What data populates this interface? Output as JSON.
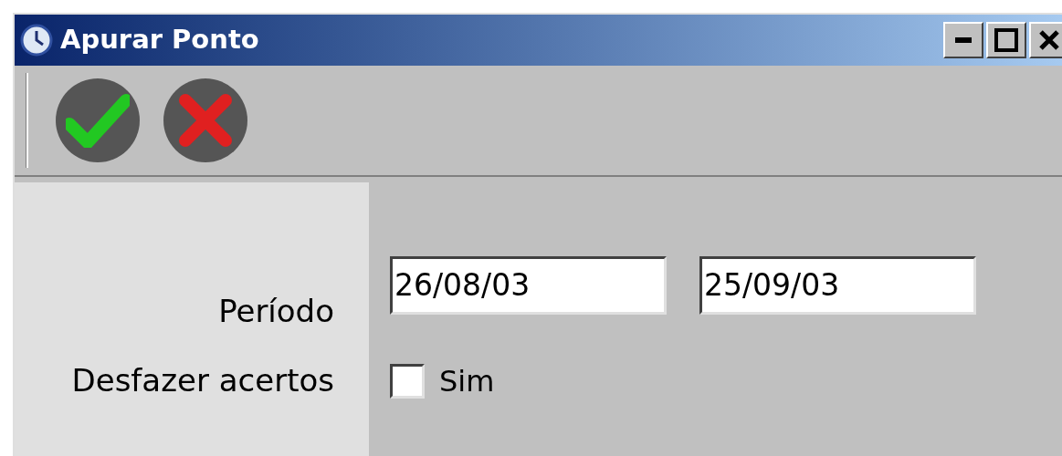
{
  "window": {
    "title": "Apurar Ponto"
  },
  "form": {
    "fields": [
      {
        "kind": "range",
        "label": "Período",
        "values": [
          "26/08/03",
          "25/09/03"
        ]
      },
      {
        "kind": "checkbox",
        "label": "Desfazer acertos",
        "option": "Sim",
        "checked": false
      }
    ]
  }
}
